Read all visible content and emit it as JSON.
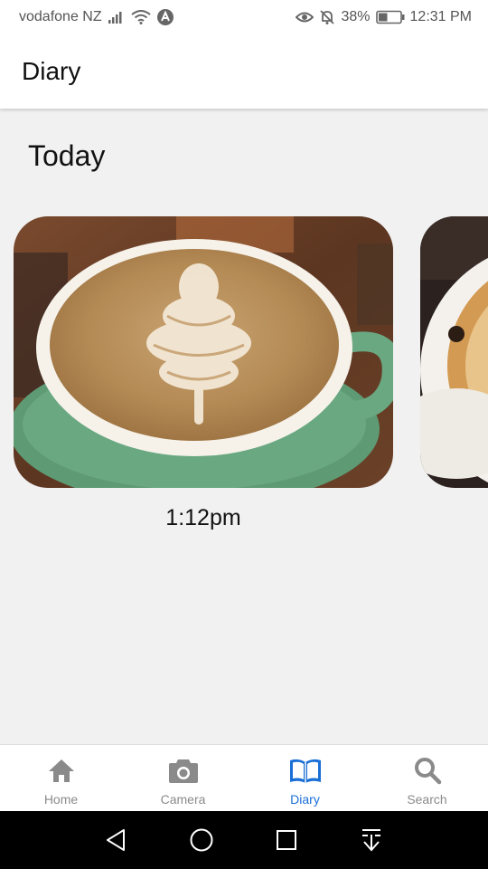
{
  "status_bar": {
    "carrier": "vodafone NZ",
    "battery": "38%",
    "time": "12:31 PM",
    "icons_left": [
      "signal-icon",
      "wifi-icon",
      "app-notification-icon"
    ],
    "icons_right": [
      "eye-icon",
      "bell-muted-icon",
      "battery-icon"
    ]
  },
  "app_bar": {
    "title": "Diary"
  },
  "main": {
    "section_title": "Today",
    "entries": [
      {
        "time": "1:12pm",
        "photo": "latte-art-coffee"
      },
      {
        "time": "",
        "photo": "pizza-plate"
      }
    ]
  },
  "bottom_nav": {
    "items": [
      {
        "label": "Home",
        "icon": "home-icon",
        "active": false
      },
      {
        "label": "Camera",
        "icon": "camera-icon",
        "active": false
      },
      {
        "label": "Diary",
        "icon": "book-open-icon",
        "active": true
      },
      {
        "label": "Search",
        "icon": "search-icon",
        "active": false
      }
    ],
    "active_color": "#1a6fd6",
    "inactive_color": "#8a8a8a"
  },
  "system_nav": {
    "buttons": [
      "back-icon",
      "home-circle-icon",
      "recents-icon",
      "notifications-pull-icon"
    ]
  }
}
